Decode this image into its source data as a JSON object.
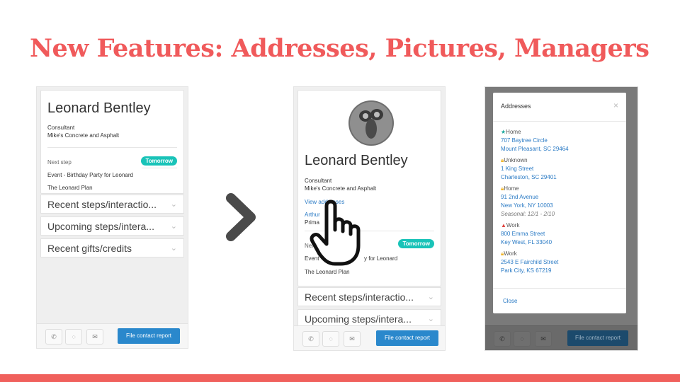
{
  "slide": {
    "title": "New Features: Addresses, Pictures, Managers"
  },
  "colors": {
    "accent": "#f05a5b",
    "teal_badge": "#19c3b8",
    "button_blue": "#2a88cc",
    "link_blue": "#2b7bc5"
  },
  "panel1": {
    "name": "Leonard Bentley",
    "title": "Consultant",
    "company": "Mike's Concrete and Asphalt",
    "next_step_label": "Next step",
    "next_step_badge": "Tomorrow",
    "next_step_event": "Event - Birthday Party for Leonard",
    "plan": "The Leonard Plan",
    "sections": [
      "Recent steps/interactio...",
      "Upcoming steps/intera...",
      "Recent gifts/credits"
    ],
    "report_button": "File contact report",
    "footer_icons": [
      "phone-icon",
      "chat-icon",
      "email-icon"
    ]
  },
  "panel2": {
    "name": "Leonard Bentley",
    "title": "Consultant",
    "company": "Mike's Concrete and Asphalt",
    "view_addresses": "View addresses",
    "manager_link": "Arthur",
    "manager_role": "Prima",
    "next_label": "Nex",
    "next_step_badge": "Tomorrow",
    "event_prefix": "Event",
    "event_suffix": "y for Leonard",
    "plan": "The Leonard Plan",
    "sections": [
      "Recent steps/interactio...",
      "Upcoming steps/intera..."
    ],
    "report_button": "File contact report",
    "avatar_icon": "profile-photo",
    "cursor_icon": "hand-pointer-icon"
  },
  "panel3": {
    "modal_title": "Addresses",
    "close_x": "×",
    "addresses": [
      {
        "type": "Home",
        "icon": "star-icon",
        "icon_color": "#19a89c",
        "line1": "707 Baytree Circle",
        "line2": "Mount Pleasant, SC  29464",
        "note": ""
      },
      {
        "type": "Unknown",
        "icon": "lock-icon",
        "icon_color": "#f0b429",
        "line1": "1 King Street",
        "line2": "Charleston, SC  29401",
        "note": ""
      },
      {
        "type": "Home",
        "icon": "lock-icon",
        "icon_color": "#f0b429",
        "line1": "91 2nd Avenue",
        "line2": "New York, NY  10003",
        "note": "Seasonal: 12/1 - 2/10"
      },
      {
        "type": "Work",
        "icon": "warning-icon",
        "icon_color": "#e0443e",
        "line1": "800 Emma Street",
        "line2": "Key West, FL  33040",
        "note": ""
      },
      {
        "type": "Work",
        "icon": "lock-icon",
        "icon_color": "#f0b429",
        "line1": "2543 E Fairchild Street",
        "line2": "Park City, KS  67219",
        "note": ""
      }
    ],
    "close_label": "Close",
    "report_button": "File contact report"
  }
}
